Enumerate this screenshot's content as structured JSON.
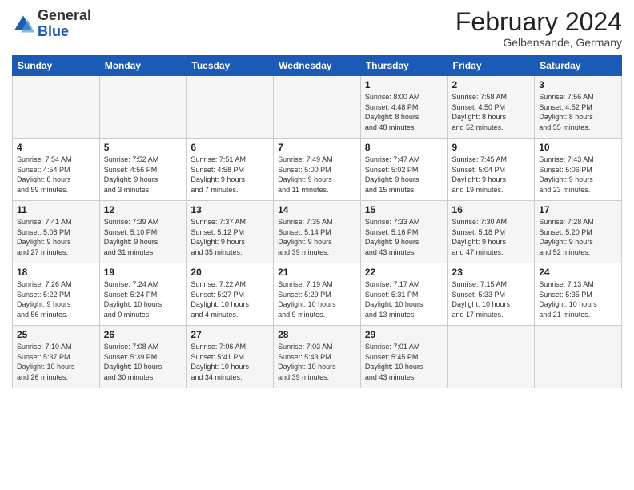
{
  "header": {
    "logo_general": "General",
    "logo_blue": "Blue",
    "month_title": "February 2024",
    "subtitle": "Gelbensande, Germany"
  },
  "days_of_week": [
    "Sunday",
    "Monday",
    "Tuesday",
    "Wednesday",
    "Thursday",
    "Friday",
    "Saturday"
  ],
  "weeks": [
    [
      {
        "day": "",
        "info": ""
      },
      {
        "day": "",
        "info": ""
      },
      {
        "day": "",
        "info": ""
      },
      {
        "day": "",
        "info": ""
      },
      {
        "day": "1",
        "info": "Sunrise: 8:00 AM\nSunset: 4:48 PM\nDaylight: 8 hours\nand 48 minutes."
      },
      {
        "day": "2",
        "info": "Sunrise: 7:58 AM\nSunset: 4:50 PM\nDaylight: 8 hours\nand 52 minutes."
      },
      {
        "day": "3",
        "info": "Sunrise: 7:56 AM\nSunset: 4:52 PM\nDaylight: 8 hours\nand 55 minutes."
      }
    ],
    [
      {
        "day": "4",
        "info": "Sunrise: 7:54 AM\nSunset: 4:54 PM\nDaylight: 8 hours\nand 59 minutes."
      },
      {
        "day": "5",
        "info": "Sunrise: 7:52 AM\nSunset: 4:56 PM\nDaylight: 9 hours\nand 3 minutes."
      },
      {
        "day": "6",
        "info": "Sunrise: 7:51 AM\nSunset: 4:58 PM\nDaylight: 9 hours\nand 7 minutes."
      },
      {
        "day": "7",
        "info": "Sunrise: 7:49 AM\nSunset: 5:00 PM\nDaylight: 9 hours\nand 11 minutes."
      },
      {
        "day": "8",
        "info": "Sunrise: 7:47 AM\nSunset: 5:02 PM\nDaylight: 9 hours\nand 15 minutes."
      },
      {
        "day": "9",
        "info": "Sunrise: 7:45 AM\nSunset: 5:04 PM\nDaylight: 9 hours\nand 19 minutes."
      },
      {
        "day": "10",
        "info": "Sunrise: 7:43 AM\nSunset: 5:06 PM\nDaylight: 9 hours\nand 23 minutes."
      }
    ],
    [
      {
        "day": "11",
        "info": "Sunrise: 7:41 AM\nSunset: 5:08 PM\nDaylight: 9 hours\nand 27 minutes."
      },
      {
        "day": "12",
        "info": "Sunrise: 7:39 AM\nSunset: 5:10 PM\nDaylight: 9 hours\nand 31 minutes."
      },
      {
        "day": "13",
        "info": "Sunrise: 7:37 AM\nSunset: 5:12 PM\nDaylight: 9 hours\nand 35 minutes."
      },
      {
        "day": "14",
        "info": "Sunrise: 7:35 AM\nSunset: 5:14 PM\nDaylight: 9 hours\nand 39 minutes."
      },
      {
        "day": "15",
        "info": "Sunrise: 7:33 AM\nSunset: 5:16 PM\nDaylight: 9 hours\nand 43 minutes."
      },
      {
        "day": "16",
        "info": "Sunrise: 7:30 AM\nSunset: 5:18 PM\nDaylight: 9 hours\nand 47 minutes."
      },
      {
        "day": "17",
        "info": "Sunrise: 7:28 AM\nSunset: 5:20 PM\nDaylight: 9 hours\nand 52 minutes."
      }
    ],
    [
      {
        "day": "18",
        "info": "Sunrise: 7:26 AM\nSunset: 5:22 PM\nDaylight: 9 hours\nand 56 minutes."
      },
      {
        "day": "19",
        "info": "Sunrise: 7:24 AM\nSunset: 5:24 PM\nDaylight: 10 hours\nand 0 minutes."
      },
      {
        "day": "20",
        "info": "Sunrise: 7:22 AM\nSunset: 5:27 PM\nDaylight: 10 hours\nand 4 minutes."
      },
      {
        "day": "21",
        "info": "Sunrise: 7:19 AM\nSunset: 5:29 PM\nDaylight: 10 hours\nand 9 minutes."
      },
      {
        "day": "22",
        "info": "Sunrise: 7:17 AM\nSunset: 5:31 PM\nDaylight: 10 hours\nand 13 minutes."
      },
      {
        "day": "23",
        "info": "Sunrise: 7:15 AM\nSunset: 5:33 PM\nDaylight: 10 hours\nand 17 minutes."
      },
      {
        "day": "24",
        "info": "Sunrise: 7:13 AM\nSunset: 5:35 PM\nDaylight: 10 hours\nand 21 minutes."
      }
    ],
    [
      {
        "day": "25",
        "info": "Sunrise: 7:10 AM\nSunset: 5:37 PM\nDaylight: 10 hours\nand 26 minutes."
      },
      {
        "day": "26",
        "info": "Sunrise: 7:08 AM\nSunset: 5:39 PM\nDaylight: 10 hours\nand 30 minutes."
      },
      {
        "day": "27",
        "info": "Sunrise: 7:06 AM\nSunset: 5:41 PM\nDaylight: 10 hours\nand 34 minutes."
      },
      {
        "day": "28",
        "info": "Sunrise: 7:03 AM\nSunset: 5:43 PM\nDaylight: 10 hours\nand 39 minutes."
      },
      {
        "day": "29",
        "info": "Sunrise: 7:01 AM\nSunset: 5:45 PM\nDaylight: 10 hours\nand 43 minutes."
      },
      {
        "day": "",
        "info": ""
      },
      {
        "day": "",
        "info": ""
      }
    ]
  ]
}
